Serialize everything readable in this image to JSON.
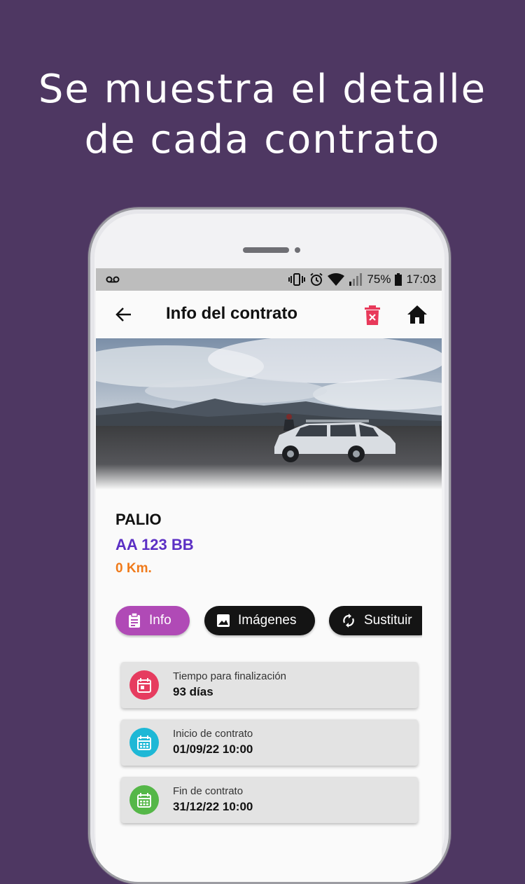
{
  "headline": {
    "line1": "Se muestra el detalle",
    "line2": "de cada contrato"
  },
  "status_bar": {
    "voicemail_icon": "voicemail-icon",
    "battery_percent": "75%",
    "time": "17:03"
  },
  "app_bar": {
    "title": "Info del contrato",
    "back_icon": "arrow-left-icon",
    "delete_icon": "trash-icon",
    "home_icon": "home-icon",
    "delete_color": "#e8395a"
  },
  "vehicle": {
    "model": "PALIO",
    "plate": "AA 123 BB",
    "km": "0 Km."
  },
  "tabs": [
    {
      "label": "Info",
      "icon": "clipboard-icon",
      "active": true,
      "color": "#b04ab6"
    },
    {
      "label": "Imágenes",
      "icon": "image-icon",
      "active": false,
      "color": "#141414"
    },
    {
      "label": "Sustituir",
      "icon": "sync-icon",
      "active": false,
      "color": "#141414"
    }
  ],
  "cards": [
    {
      "label": "Tiempo para finalización",
      "value": "93 días",
      "icon": "calendar-event-icon",
      "color": "#e63c5f"
    },
    {
      "label": "Inicio de contrato",
      "value": "01/09/22 10:00",
      "icon": "calendar-icon",
      "color": "#1eb8d6"
    },
    {
      "label": "Fin de contrato",
      "value": "31/12/22 10:00",
      "icon": "calendar-icon",
      "color": "#55b748"
    }
  ],
  "colors": {
    "background": "#4e3762",
    "plate": "#5b2fc4",
    "km": "#f07a1a"
  }
}
